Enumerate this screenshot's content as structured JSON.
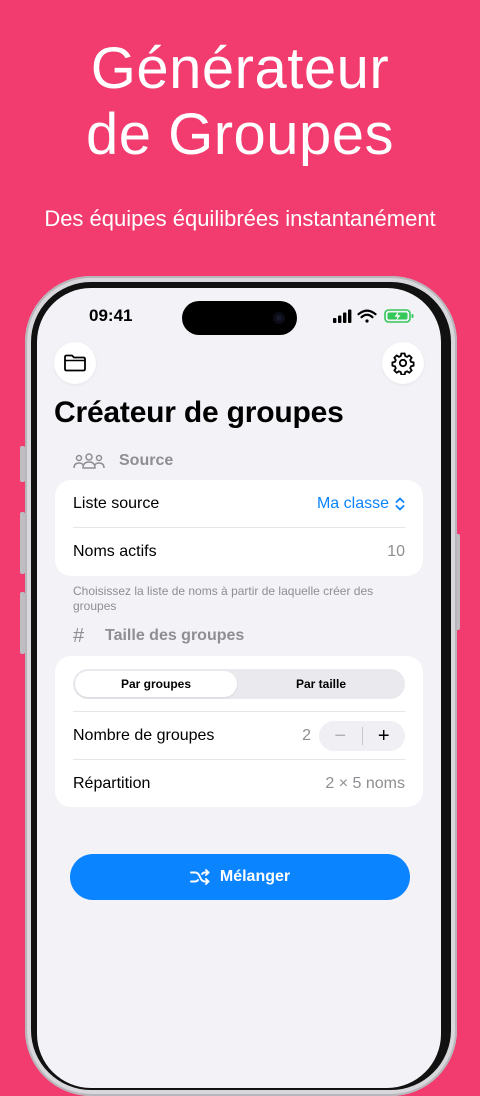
{
  "hero": {
    "title_line1": "Générateur",
    "title_line2": "de Groupes",
    "subtitle": "Des équipes équilibrées instantanément"
  },
  "status_bar": {
    "time": "09:41",
    "icons": [
      "cellular-signal-icon",
      "wifi-icon",
      "battery-charging-icon"
    ]
  },
  "toolbar": {
    "left_icon": "folder-icon",
    "right_icon": "gear-icon"
  },
  "page_title": "Créateur de groupes",
  "source_section": {
    "header": "Source",
    "header_icon": "people-group-icon",
    "rows": {
      "source_list_label": "Liste source",
      "source_list_value": "Ma classe",
      "active_names_label": "Noms actifs",
      "active_names_value": "10"
    },
    "footnote": "Choisissez la liste de noms à partir de laquelle créer des groupes"
  },
  "size_section": {
    "header": "Taille des groupes",
    "header_icon": "number-sign-icon",
    "segments": [
      "Par groupes",
      "Par taille"
    ],
    "selected_segment": "Par groupes",
    "group_count_label": "Nombre de groupes",
    "group_count_value": "2",
    "stepper_minus": "−",
    "stepper_plus": "+",
    "distribution_label": "Répartition",
    "distribution_value": "2 × 5 noms"
  },
  "action": {
    "shuffle_label": "Mélanger",
    "shuffle_icon": "shuffle-icon"
  },
  "colors": {
    "background": "#F23B6E",
    "accent": "#0A84FF",
    "battery": "#34C759"
  }
}
